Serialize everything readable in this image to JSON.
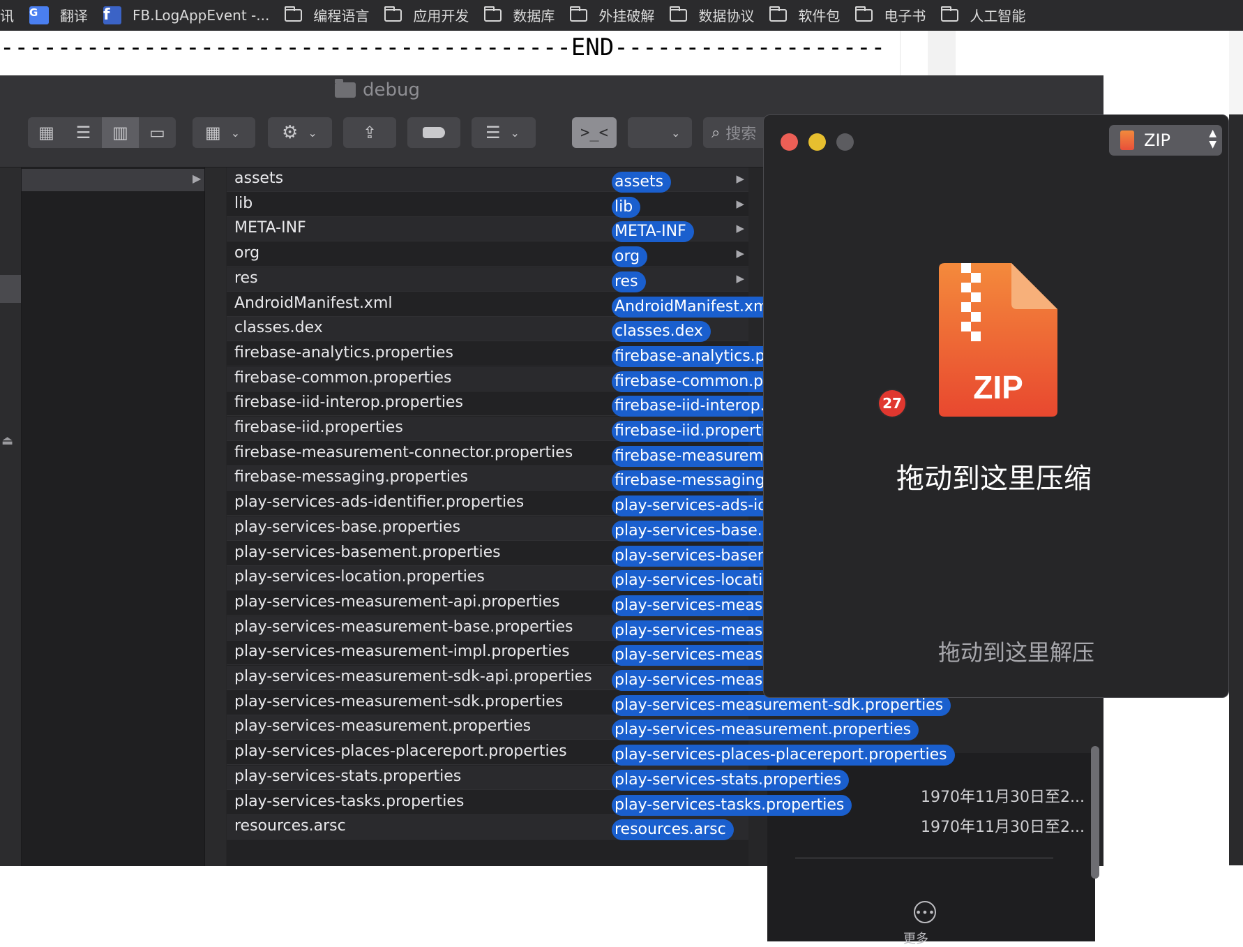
{
  "bookmarks": [
    {
      "label": "讯",
      "icon": "none"
    },
    {
      "label": "翻译",
      "icon": "google-translate-icon"
    },
    {
      "label": "FB.LogAppEvent -...",
      "icon": "facebook-icon"
    },
    {
      "label": "编程语言",
      "icon": "folder-icon"
    },
    {
      "label": "应用开发",
      "icon": "folder-icon"
    },
    {
      "label": "数据库",
      "icon": "folder-icon"
    },
    {
      "label": "外挂破解",
      "icon": "folder-icon"
    },
    {
      "label": "数据协议",
      "icon": "folder-icon"
    },
    {
      "label": "软件包",
      "icon": "folder-icon"
    },
    {
      "label": "电子书",
      "icon": "folder-icon"
    },
    {
      "label": "人工智能",
      "icon": "folder-icon"
    }
  ],
  "background_page": {
    "end_line": "----------------------------------------END----------------------------------------------------------------"
  },
  "finder": {
    "title": "debug",
    "search_placeholder": "搜索",
    "files": [
      {
        "name": "assets",
        "folder": true
      },
      {
        "name": "lib",
        "folder": true
      },
      {
        "name": "META-INF",
        "folder": true
      },
      {
        "name": "org",
        "folder": true
      },
      {
        "name": "res",
        "folder": true
      },
      {
        "name": "AndroidManifest.xml",
        "folder": false
      },
      {
        "name": "classes.dex",
        "folder": false
      },
      {
        "name": "firebase-analytics.properties",
        "folder": false
      },
      {
        "name": "firebase-common.properties",
        "folder": false
      },
      {
        "name": "firebase-iid-interop.properties",
        "folder": false
      },
      {
        "name": "firebase-iid.properties",
        "folder": false
      },
      {
        "name": "firebase-measurement-connector.properties",
        "folder": false
      },
      {
        "name": "firebase-messaging.properties",
        "folder": false
      },
      {
        "name": "play-services-ads-identifier.properties",
        "folder": false
      },
      {
        "name": "play-services-base.properties",
        "folder": false
      },
      {
        "name": "play-services-basement.properties",
        "folder": false
      },
      {
        "name": "play-services-location.properties",
        "folder": false
      },
      {
        "name": "play-services-measurement-api.properties",
        "folder": false
      },
      {
        "name": "play-services-measurement-base.properties",
        "folder": false
      },
      {
        "name": "play-services-measurement-impl.properties",
        "folder": false
      },
      {
        "name": "play-services-measurement-sdk-api.properties",
        "folder": false
      },
      {
        "name": "play-services-measurement-sdk.properties",
        "folder": false
      },
      {
        "name": "play-services-measurement.properties",
        "folder": false
      },
      {
        "name": "play-services-places-placereport.properties",
        "folder": false
      },
      {
        "name": "play-services-stats.properties",
        "folder": false
      },
      {
        "name": "play-services-tasks.properties",
        "folder": false
      },
      {
        "name": "resources.arsc",
        "folder": false
      }
    ],
    "info": {
      "line1": "1970年11月30日至2...",
      "line2": "1970年11月30日至2...",
      "more_label": "更多"
    }
  },
  "zip_panel": {
    "format": "ZIP",
    "icon_text": "ZIP",
    "compress_label": "拖动到这里压缩",
    "extract_label": "拖动到这里解压",
    "drag_count": "27"
  },
  "colors": {
    "pill": "#1a5fce",
    "badge": "#e0372f",
    "traffic_red": "#ec5f56",
    "traffic_yellow": "#e7bf2f",
    "traffic_gray": "#5c5c60"
  }
}
